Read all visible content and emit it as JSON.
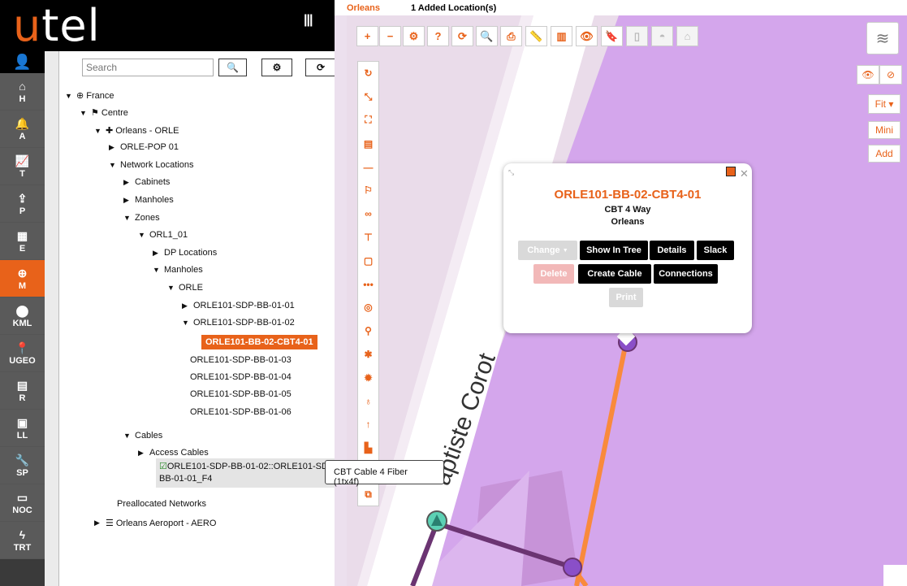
{
  "brand": {
    "logo_u": "u",
    "logo_rest": "tel"
  },
  "nav": {
    "items": [
      {
        "icon": "⌂",
        "label": "H"
      },
      {
        "icon": "🔔",
        "label": "A"
      },
      {
        "icon": "📈",
        "label": "T"
      },
      {
        "icon": "⇪",
        "label": "P"
      },
      {
        "icon": "▦",
        "label": "E"
      },
      {
        "icon": "⊕",
        "label": "M"
      },
      {
        "icon": "⬤",
        "label": "KML"
      },
      {
        "icon": "📍",
        "label": "UGEO"
      },
      {
        "icon": "▤",
        "label": "R"
      },
      {
        "icon": "▣",
        "label": "LL"
      },
      {
        "icon": "🔧",
        "label": "SP"
      },
      {
        "icon": "▭",
        "label": "NOC"
      },
      {
        "icon": "ϟ",
        "label": "TRT"
      }
    ],
    "active": "M"
  },
  "tree": {
    "search_placeholder": "Search",
    "rows": [
      {
        "arrow": "▼",
        "icon": "⊕",
        "label": "France"
      },
      {
        "arrow": "▼",
        "icon": "⚑",
        "label": "Centre"
      },
      {
        "arrow": "▼",
        "icon": "✚",
        "label": "Orleans - ORLE"
      },
      {
        "arrow": "▶",
        "icon": "",
        "label": "ORLE-POP 01"
      },
      {
        "arrow": "▼",
        "icon": "",
        "label": "Network Locations"
      },
      {
        "arrow": "▶",
        "icon": "",
        "label": "Cabinets"
      },
      {
        "arrow": "▶",
        "icon": "",
        "label": "Manholes"
      },
      {
        "arrow": "▼",
        "icon": "",
        "label": "Zones"
      },
      {
        "arrow": "▼",
        "icon": "",
        "label": "ORL1_01"
      },
      {
        "arrow": "▶",
        "icon": "",
        "label": "DP Locations"
      },
      {
        "arrow": "▼",
        "icon": "",
        "label": "Manholes"
      },
      {
        "arrow": "▼",
        "icon": "",
        "label": "ORLE"
      },
      {
        "arrow": "▶",
        "icon": "",
        "label": "ORLE101-SDP-BB-01-01"
      },
      {
        "arrow": "▼",
        "icon": "",
        "label": "ORLE101-SDP-BB-01-02"
      },
      {
        "arrow": "",
        "icon": "",
        "label": "ORLE101-BB-02-CBT4-01"
      },
      {
        "arrow": "",
        "icon": "",
        "label": "ORLE101-SDP-BB-01-03"
      },
      {
        "arrow": "",
        "icon": "",
        "label": "ORLE101-SDP-BB-01-04"
      },
      {
        "arrow": "",
        "icon": "",
        "label": "ORLE101-SDP-BB-01-05"
      },
      {
        "arrow": "",
        "icon": "",
        "label": "ORLE101-SDP-BB-01-06"
      },
      {
        "arrow": "▼",
        "icon": "",
        "label": "Cables"
      },
      {
        "arrow": "▶",
        "icon": "",
        "label": "Access Cables"
      },
      {
        "arrow": "",
        "icon": "",
        "label": "Preallocated Networks"
      },
      {
        "arrow": "▶",
        "icon": "☰",
        "label": "Orleans Aeroport - AERO"
      }
    ],
    "cable_line1": "ORLE101-SDP-BB-01-02::ORLE101-SDP-",
    "cable_line2": "BB-01-01_F4",
    "tooltip": "CBT Cable 4 Fiber (1tx4f)"
  },
  "map": {
    "location": "Orleans",
    "added": "1 Added Location(s)",
    "street_label": "aptiste Corot",
    "right_buttons": {
      "fit": "Fit ▾",
      "mini": "Mini",
      "add": "Add"
    }
  },
  "popup": {
    "title": "ORLE101-BB-02-CBT4-01",
    "subtitle1": "CBT 4 Way",
    "subtitle2": "Orleans",
    "buttons": {
      "change": "Change",
      "show_in_tree": "Show In Tree",
      "details": "Details",
      "slack": "Slack",
      "delete": "Delete",
      "create_cable": "Create Cable",
      "connections": "Connections",
      "print": "Print"
    }
  },
  "colors": {
    "accent": "#e8621a",
    "map_zone": "#d4a6ec",
    "map_road": "#ffffff",
    "cable_orange": "#f98a3c",
    "cable_purple": "#6b3472"
  }
}
